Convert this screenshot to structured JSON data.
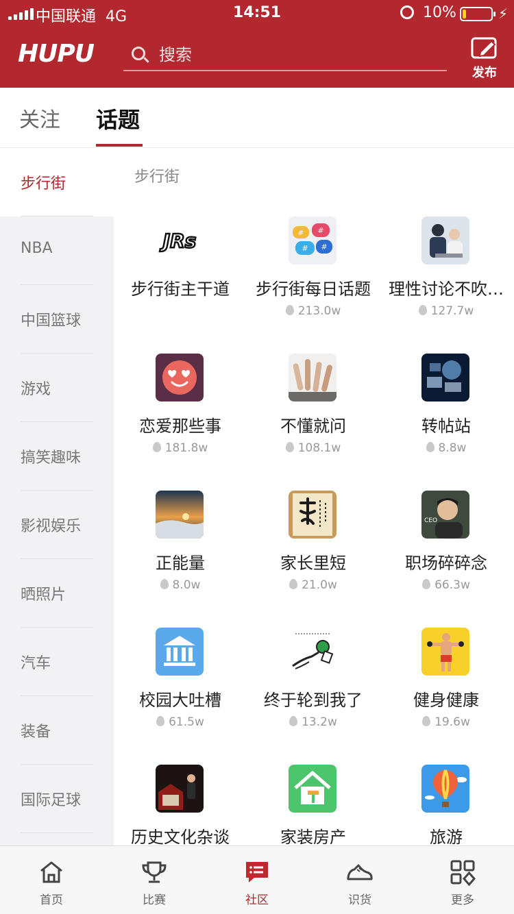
{
  "status_bar": {
    "carrier": "中国联通",
    "network": "4G",
    "time": "14:51",
    "battery": "10%",
    "icons": [
      "signal-icon",
      "alarm-icon",
      "battery-icon",
      "charging-icon"
    ]
  },
  "header": {
    "logo": "HUPU",
    "search_placeholder": "搜索",
    "publish_label": "发布",
    "brand_color": "#b3272e"
  },
  "tabs": [
    {
      "label": "关注",
      "active": false
    },
    {
      "label": "话题",
      "active": true
    }
  ],
  "sidebar": {
    "items": [
      {
        "label": "步行街",
        "active": true
      },
      {
        "label": "NBA"
      },
      {
        "label": "中国篮球"
      },
      {
        "label": "游戏"
      },
      {
        "label": "搞笑趣味"
      },
      {
        "label": "影视娱乐"
      },
      {
        "label": "晒照片"
      },
      {
        "label": "汽车"
      },
      {
        "label": "装备"
      },
      {
        "label": "国际足球"
      }
    ]
  },
  "content": {
    "section_title": "步行街",
    "topics": [
      {
        "name": "步行街主干道",
        "heat": "",
        "icon": "jrs-logo"
      },
      {
        "name": "步行街每日话题",
        "heat": "213.0w",
        "icon": "hashtag-bubbles-icon"
      },
      {
        "name": "理性讨论不吹…",
        "heat": "127.7w",
        "icon": "discussion-photo"
      },
      {
        "name": "恋爱那些事",
        "heat": "181.8w",
        "icon": "heart-eyes-emoji-icon"
      },
      {
        "name": "不懂就问",
        "heat": "108.1w",
        "icon": "raised-hands-photo"
      },
      {
        "name": "转帖站",
        "heat": "8.8w",
        "icon": "tech-screens-photo"
      },
      {
        "name": "正能量",
        "heat": "8.0w",
        "icon": "sunrise-photo"
      },
      {
        "name": "家长里短",
        "heat": "21.0w",
        "icon": "calligraphy-photo"
      },
      {
        "name": "职场碎碎念",
        "heat": "66.3w",
        "icon": "ceo-portrait-photo"
      },
      {
        "name": "校园大吐槽",
        "heat": "61.5w",
        "icon": "school-building-icon"
      },
      {
        "name": "终于轮到我了",
        "heat": "13.2w",
        "icon": "microphone-sketch-icon"
      },
      {
        "name": "健身健康",
        "heat": "19.6w",
        "icon": "fitness-man-icon"
      },
      {
        "name": "历史文化杂谈",
        "heat": "",
        "icon": "lecture-photo"
      },
      {
        "name": "家装房产",
        "heat": "",
        "icon": "house-paint-icon"
      },
      {
        "name": "旅游",
        "heat": "",
        "icon": "hot-air-balloon-icon"
      }
    ]
  },
  "bottom_nav": [
    {
      "label": "首页",
      "icon": "home-icon",
      "active": false
    },
    {
      "label": "比赛",
      "icon": "trophy-icon",
      "active": false
    },
    {
      "label": "社区",
      "icon": "community-chat-icon",
      "active": true
    },
    {
      "label": "识货",
      "icon": "sneaker-icon",
      "active": false
    },
    {
      "label": "更多",
      "icon": "more-grid-icon",
      "active": false
    }
  ]
}
